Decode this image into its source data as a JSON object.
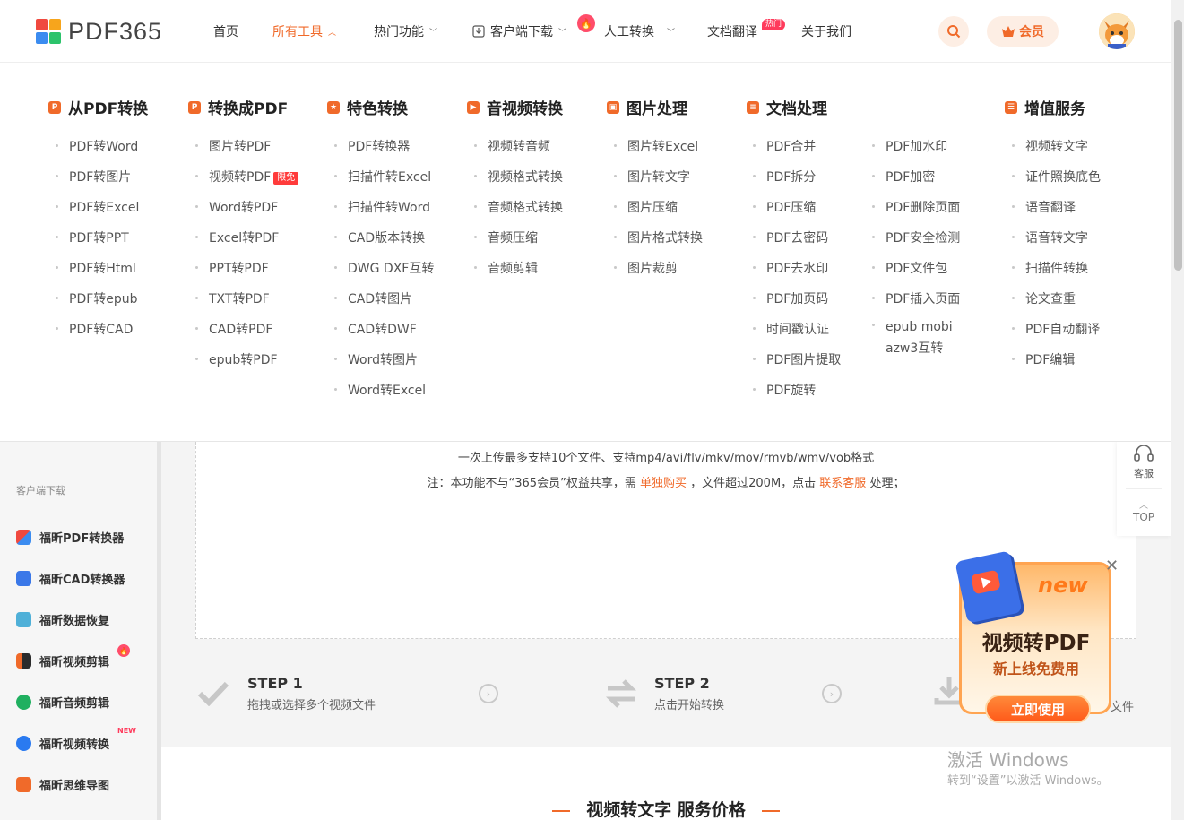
{
  "header": {
    "logo_text": "PDF365",
    "nav": [
      {
        "label": "首页"
      },
      {
        "label": "所有工具",
        "active": true
      },
      {
        "label": "热门功能"
      },
      {
        "label": "客户端下载"
      },
      {
        "label": "人工转换"
      },
      {
        "label": "文档翻译",
        "badge": "热门"
      },
      {
        "label": "关于我们"
      }
    ],
    "member_label": "会员"
  },
  "mega_menu": {
    "categories": [
      {
        "title": "从PDF转换",
        "items": [
          "PDF转Word",
          "PDF转图片",
          "PDF转Excel",
          "PDF转PPT",
          "PDF转Html",
          "PDF转epub",
          "PDF转CAD"
        ]
      },
      {
        "title": "转换成PDF",
        "items": [
          "图片转PDF",
          "视频转PDF",
          "Word转PDF",
          "Excel转PDF",
          "PPT转PDF",
          "TXT转PDF",
          "CAD转PDF",
          "epub转PDF"
        ],
        "tag": "限免"
      },
      {
        "title": "特色转换",
        "items": [
          "PDF转换器",
          "扫描件转Excel",
          "扫描件转Word",
          "CAD版本转换",
          "DWG DXF互转",
          "CAD转图片",
          "CAD转DWF",
          "Word转图片",
          "Word转Excel"
        ]
      },
      {
        "title": "音视频转换",
        "items": [
          "视频转音频",
          "视频格式转换",
          "音频格式转换",
          "音频压缩",
          "音频剪辑"
        ]
      },
      {
        "title": "图片处理",
        "items": [
          "图片转Excel",
          "图片转文字",
          "图片压缩",
          "图片格式转换",
          "图片裁剪"
        ]
      },
      {
        "title": "文档处理",
        "items": [
          "PDF合并",
          "PDF拆分",
          "PDF压缩",
          "PDF去密码",
          "PDF去水印",
          "PDF加页码",
          "时间戳认证",
          "PDF图片提取",
          "PDF旋转"
        ],
        "items2": [
          "PDF加水印",
          "PDF加密",
          "PDF删除页面",
          "PDF安全检测",
          "PDF文件包",
          "PDF插入页面",
          "epub mobi",
          "azw3互转"
        ]
      },
      {
        "title": "增值服务",
        "items": [
          "视频转文字",
          "证件照换底色",
          "语音翻译",
          "语音转文字",
          "扫描件转换",
          "论文查重",
          "PDF自动翻译",
          "PDF编辑"
        ]
      }
    ]
  },
  "sidebar": {
    "title": "客户端下载",
    "items": [
      {
        "label": "福昕PDF转换器",
        "color": "#3b8cf0"
      },
      {
        "label": "福昕CAD转换器",
        "color": "#3b78e8"
      },
      {
        "label": "福昕数据恢复",
        "color": "#4fb0d8"
      },
      {
        "label": "福昕视频剪辑",
        "color": "#2c2c2c"
      },
      {
        "label": "福昕音频剪辑",
        "color": "#20b060"
      },
      {
        "label": "福昕视频转换",
        "color": "#2a7af0",
        "badge": "NEW"
      },
      {
        "label": "福昕思维导图",
        "color": "#f06a2a"
      }
    ]
  },
  "upload": {
    "line1": "一次上传最多支持10个文件、支持mp4/avi/flv/mkv/mov/rmvb/wmv/vob格式",
    "line2_a": "注：本功能不与“365会员”权益共享，需",
    "link_buy": "单独购买",
    "line2_b": "，文件超过200M，点击",
    "link_service": "联系客服",
    "line2_c": "处理；"
  },
  "steps": [
    {
      "num": "STEP 1",
      "desc": "拖拽或选择多个视频文件"
    },
    {
      "num": "STEP 2",
      "desc": "点击开始转换"
    },
    {
      "num": "",
      "desc": "文件"
    }
  ],
  "section_title": "视频转文字 服务价格",
  "float_service": {
    "service_label": "客服",
    "top_label": "TOP"
  },
  "promo": {
    "new_label": "new",
    "title": "视频转PDF",
    "subtitle": "新上线免费用",
    "button": "立即使用"
  },
  "watermark": {
    "line1": "激活 Windows",
    "line2": "转到“设置”以激活 Windows。"
  }
}
